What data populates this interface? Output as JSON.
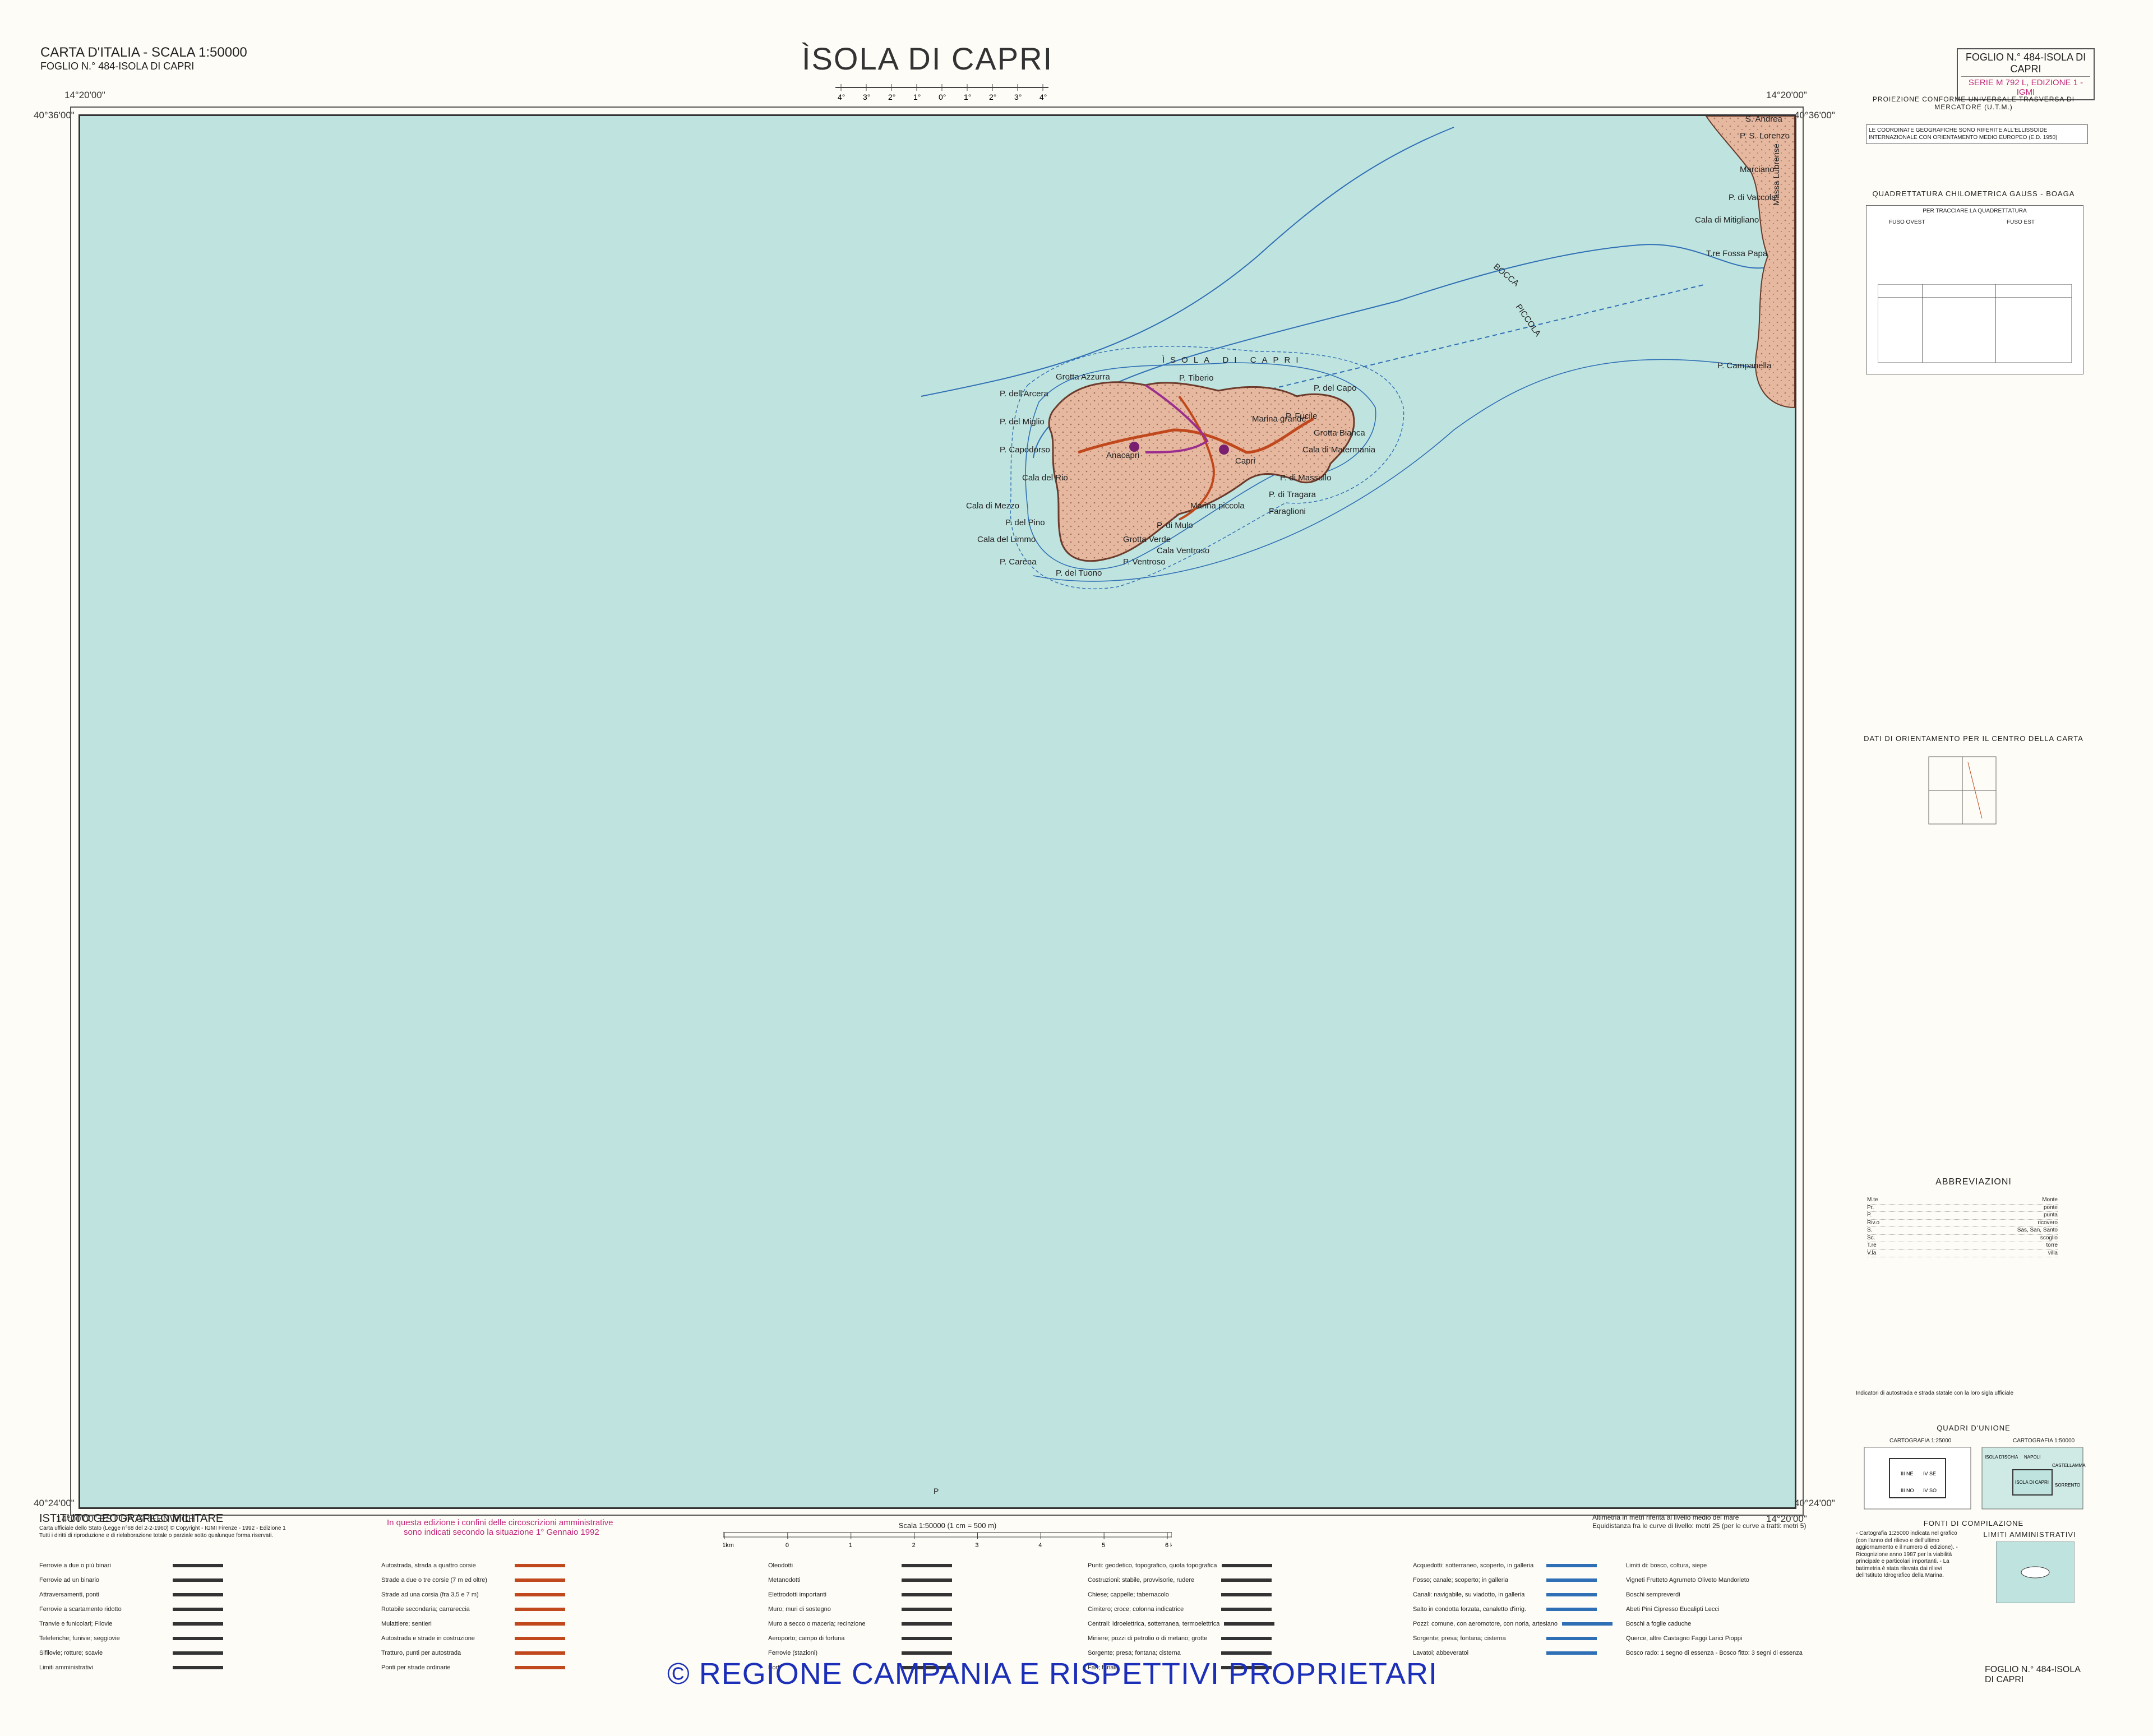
{
  "header": {
    "series_title": "CARTA D'ITALIA - SCALA 1:50000",
    "sheet_subtitle": "FOGLIO N.° 484-ISOLA DI CAPRI",
    "main_title": "ÌSOLA DI CAPRI",
    "sheet_box": "FOGLIO N.° 484-ISOLA DI CAPRI",
    "sheet_series": "SERIE M 792 L, EDIZIONE 1 - IGMI"
  },
  "coordinates": {
    "top_left_lon": "14°20'00\"",
    "top_right_lon": "14°20'00\"",
    "top_left_lat": "40°36'00\"",
    "top_right_lat": "40°36'00\"",
    "bottom_left_lat": "40°24'00\"",
    "bottom_right_lat": "40°24'00\"",
    "bottom_left_lon": "14°00'00\" EST DA GREENWICH",
    "bottom_right_lon": "14°20'00\"",
    "declination_ticks": [
      "4°",
      "3°",
      "2°",
      "1°",
      "0°",
      "1°",
      "2°",
      "3°",
      "4°"
    ]
  },
  "map": {
    "sea_color": "#bfe3df",
    "land_color": "#e7b8a0",
    "island_label": "ÌSOLA DI CAPRI",
    "strait_label_1": "BOCCA",
    "strait_label_2": "PICCOLA",
    "mainland_label": "Massa Lubrense",
    "places": [
      "P. dell'Arcera",
      "Grotta Azzurra",
      "P. Tiberio",
      "P. del Capo",
      "P. del Miglio",
      "Anacapri",
      "Capri",
      "Marina grande",
      "P. Capodorso",
      "Cala del Rio",
      "Cala di Mezzo",
      "P. del Pino",
      "Cala del Limmo",
      "P. Carena",
      "P. del Tuono",
      "Marina piccola",
      "P. di Mulo",
      "Grotta Verde",
      "P. Ventroso",
      "Cala Ventroso",
      "P. di Tragara",
      "Faraglioni",
      "P. Campanella",
      "P. S. Lorenzo",
      "Marciano",
      "P. di Vaccola",
      "Cala di Mitigliano",
      "T.re Fossa Papa",
      "S. Andrea",
      "P. Fucile",
      "Cala di Matermania",
      "Grotta Bianca",
      "P. di Massullo"
    ]
  },
  "sidebar": {
    "projection_title": "PROIEZIONE CONFORME UNIVERSALE TRASVERSA DI MERCATORE (U.T.M.)",
    "projection_note": "LE COORDINATE GEOGRAFICHE SONO RIFERITE ALL'ELLISSOIDE INTERNAZIONALE CON ORIENTAMENTO MEDIO EUROPEO (E.D. 1950)",
    "grid_title": "QUADRETTATURA CHILOMETRICA GAUSS - BOAGA",
    "grid_note": "PER TRACCIARE LA QUADRETTATURA",
    "fuso_ovest": "FUSO OVEST",
    "fuso_est": "FUSO EST",
    "orient_title": "DATI DI ORIENTAMENTO PER IL CENTRO DELLA CARTA",
    "abbr_title": "ABBREVIAZIONI",
    "abbreviations": [
      [
        "M.te",
        "Monte"
      ],
      [
        "Pr.",
        "ponte"
      ],
      [
        "P.",
        "punta"
      ],
      [
        "Riv.o",
        "ricovero"
      ],
      [
        "S.",
        "Sas, San, Santo"
      ],
      [
        "Sc.",
        "scoglio"
      ],
      [
        "T.re",
        "torre"
      ],
      [
        "V.la",
        "villa"
      ]
    ],
    "road_note": "Indicatori di autostrada e strada statale con la loro sigla ufficiale",
    "union_title": "QUADRI D'UNIONE",
    "carto_25": "CARTOGRAFIA 1:25000",
    "carto_50": "CARTOGRAFIA 1:50000",
    "limits_title": "LIMITI AMMINISTRATIVI",
    "sources_title": "FONTI DI COMPILAZIONE",
    "sources_text": "- Cartografia 1:25000 indicata nel grafico (con l'anno del rilievo e dell'ultimo aggiornamento e il numero di edizione). - Ricognizione anno 1987 per la viabilità principale e particolari importanti. - La batimetria è stata rilevata dai rilievi dell'Istituto Idrografico della Marina.",
    "sheet_footer": "FOGLIO N.° 484-ISOLA DI CAPRI",
    "union_sheets_25": [
      "III NE",
      "IV SE",
      "III NO",
      "IV SO"
    ],
    "union_sheets_50": [
      "ISOLA D'ISCHIA",
      "NAPOLI",
      "CASTELLAMMARE",
      "ISOLA DI CAPRI",
      "SORRENTO"
    ]
  },
  "footer": {
    "institute": "ISTITUTO GEOGRAFICO MILITARE",
    "official": "Carta ufficiale dello Stato (Legge n°68 del 2-2-1960) © Copyright - IGMI Firenze - 1992 - Edizione 1",
    "rights": "Tutti i diritti di riproduzione e di rielaborazione totale o parziale sotto qualunque forma riservati.",
    "admin_note_1": "In questa edizione i confini delle circoscrizioni amministrative",
    "admin_note_2": "sono indicati secondo la situazione 1° Gennaio 1992",
    "scale_label": "Scala 1:50000 (1 cm = 500 m)",
    "scale_ticks": [
      "1km",
      "0",
      "1",
      "2",
      "3",
      "4",
      "5",
      "6 km"
    ],
    "altimetry_1": "Altimetria in metri riferita al livello medio del mare",
    "altimetry_2": "Equidistanza fra le curve di livello: metri 25 (per le curve a tratti: metri 5)",
    "watermark": "© REGIONE CAMPANIA E RISPETTIVI PROPRIETARI",
    "p_marker": "P",
    "legend_col1": [
      "Ferrovie a due o più binari",
      "Ferrovie ad un binario",
      "Attraversamenti, ponti",
      "Ferrovie a scartamento ridotto",
      "Tranvie e funicolari; Filovie",
      "Teleferiche; funivie; seggiovie",
      "Sifilovie; rotture; scavie",
      "Limiti amministrativi"
    ],
    "legend_col2": [
      "Autostrada, strada a quattro corsie",
      "Strade a due o tre corsie (7 m ed oltre)",
      "Strade ad una corsia (fra 3,5 e 7 m)",
      "Rotabile secondaria; carrareccia",
      "Mulattiere; sentieri",
      "Autostrada e strade in costruzione",
      "Tratturo, punti per autostrada",
      "Ponti per strade ordinarie"
    ],
    "legend_col3": [
      "Oleodotti",
      "Metanodotti",
      "Elettrodotti importanti",
      "Muro; muri di sostegno",
      "Muro a secco o maceria; recinzione",
      "Aeroporto; campo di fortuna",
      "Ferrovie (stazioni)",
      "Porti"
    ],
    "legend_col4": [
      "Punti: geodetico, topografico, quota topografica",
      "Costruzioni: stabile, provvisorie, rudere",
      "Chiese; cappelle; tabernacolo",
      "Cimitero; croce; colonna indicatrice",
      "Centrali: idroelettrica, sotterranea, termoelettrica",
      "Miniere; pozzi di petrolio o di metano; grotte",
      "Sorgente; presa; fontana; cisterna",
      "Fari; fanali"
    ],
    "legend_col5": [
      "Acquedotti: sotterraneo, scoperto, in galleria",
      "Fosso; canale; scoperto; in galleria",
      "Canali: navigabile, su viadotto, in galleria",
      "Salto in condotta forzata, canaletto d'irrig.",
      "Pozzi: comune, con aeromotore, con noria, artesiano",
      "Sorgente; presa; fontana; cisterna",
      "Lavatoi; abbeveratoi"
    ],
    "legend_col6": [
      "Limiti di: bosco, coltura, siepe",
      "Vigneti  Frutteto  Agrumeto  Oliveto  Mandorleto",
      "Boschi sempreverdi",
      "Abeti  Pini  Cipresso  Eucalipti  Lecci",
      "Boschi a foglie caduche",
      "Querce, altre  Castagno  Faggi  Larici  Pioppi",
      "Bosco rado: 1 segno di essenza - Bosco fitto: 3 segni di essenza"
    ]
  },
  "colors": {
    "frame": "#333333",
    "sea": "#bfe3df",
    "land": "#e7b8a0",
    "road": "#c0481c",
    "boundary": "#9b2d8f",
    "bathymetry": "#2f6fb5",
    "watermark": "#1c2fb8"
  }
}
